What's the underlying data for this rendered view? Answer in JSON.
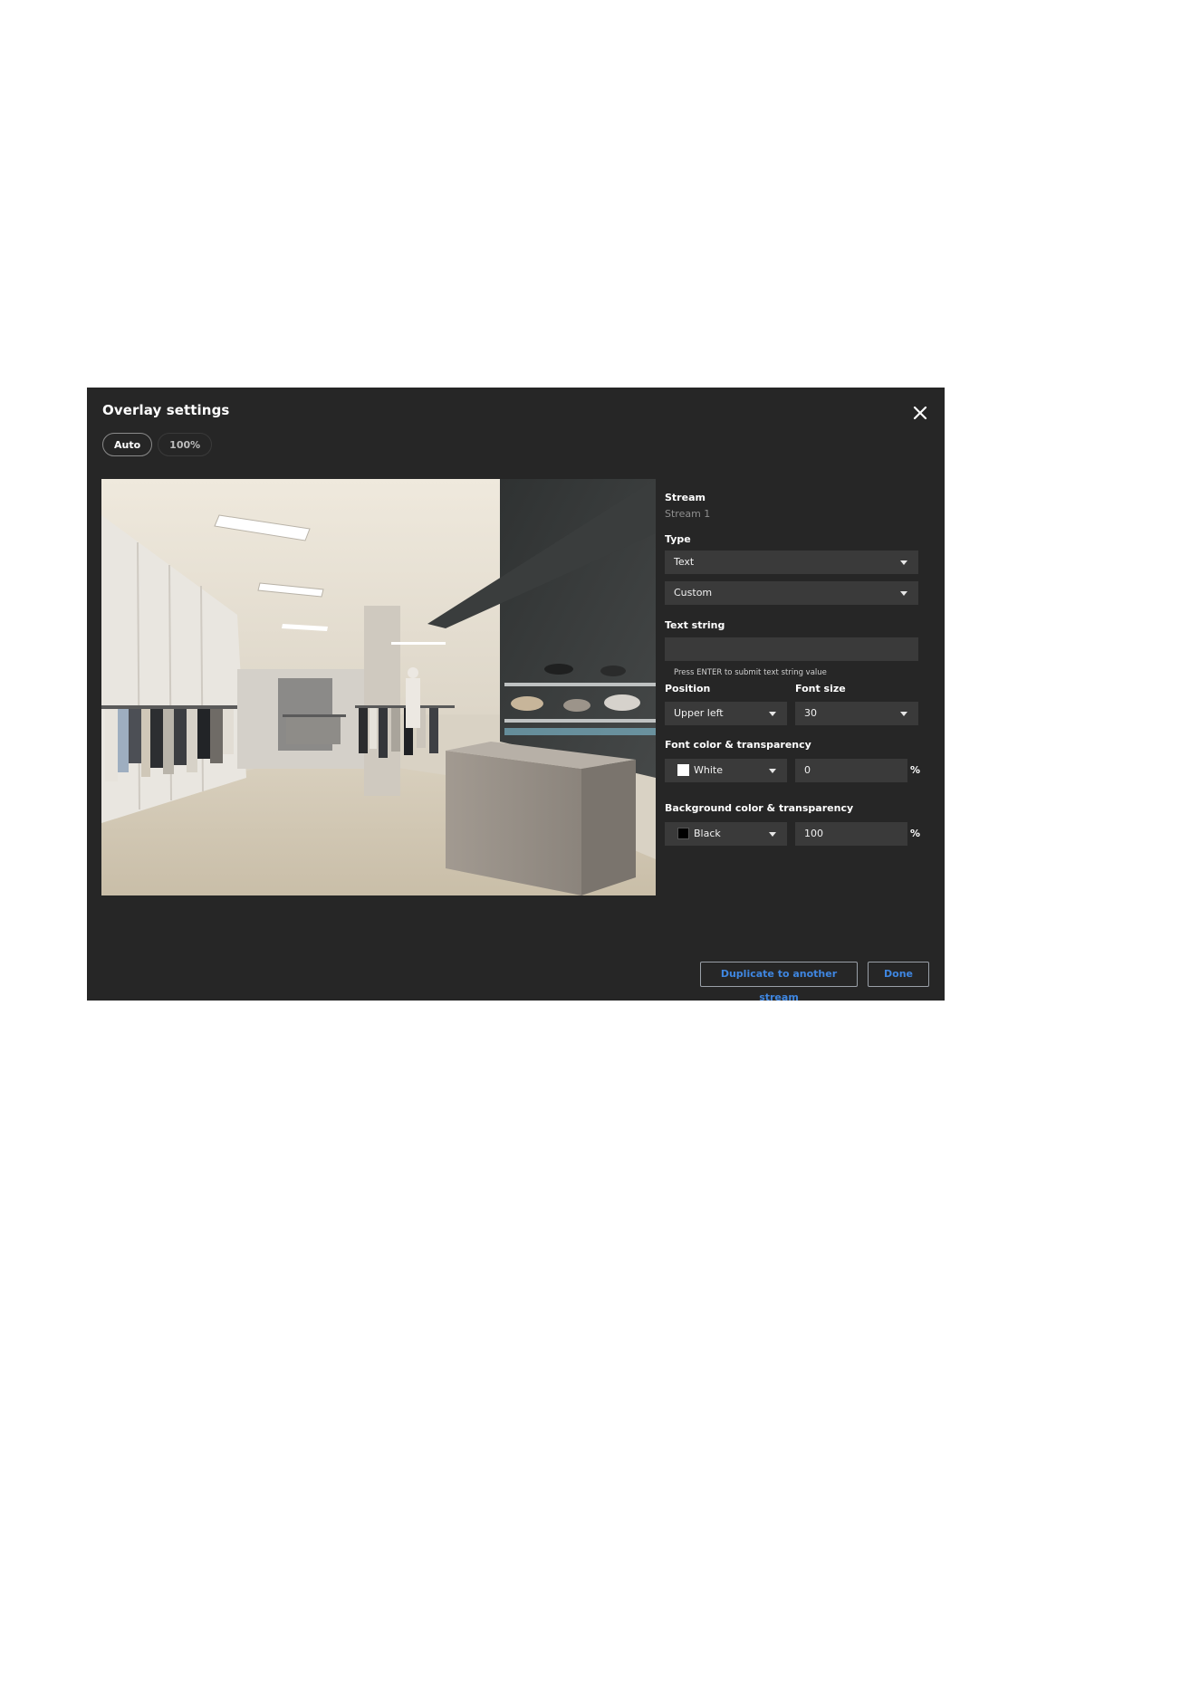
{
  "dialog": {
    "title": "Overlay settings",
    "close_icon": "close-icon",
    "zoom": {
      "auto_label": "Auto",
      "full_label": "100%",
      "selected": "Auto"
    }
  },
  "settings": {
    "stream_label": "Stream",
    "stream_value": "Stream 1",
    "type_label": "Type",
    "type_value": "Text",
    "type_sub_value": "Custom",
    "text_string_label": "Text string",
    "text_string_value": "",
    "text_string_hint": "Press ENTER to submit text string value",
    "position_label": "Position",
    "position_value": "Upper left",
    "font_size_label": "Font size",
    "font_size_value": "30",
    "font_color_label": "Font color & transparency",
    "font_color_value": "White",
    "font_color_swatch": "#ffffff",
    "font_transparency": "0",
    "bg_color_label": "Background color & transparency",
    "bg_color_value": "Black",
    "bg_color_swatch": "#000000",
    "bg_transparency": "100",
    "percent_symbol": "%"
  },
  "footer": {
    "duplicate_label": "Duplicate to another stream",
    "done_label": "Done"
  },
  "colors": {
    "dialog_bg": "#262626",
    "control_bg": "#3a3a3a",
    "accent": "#3f86e0"
  }
}
